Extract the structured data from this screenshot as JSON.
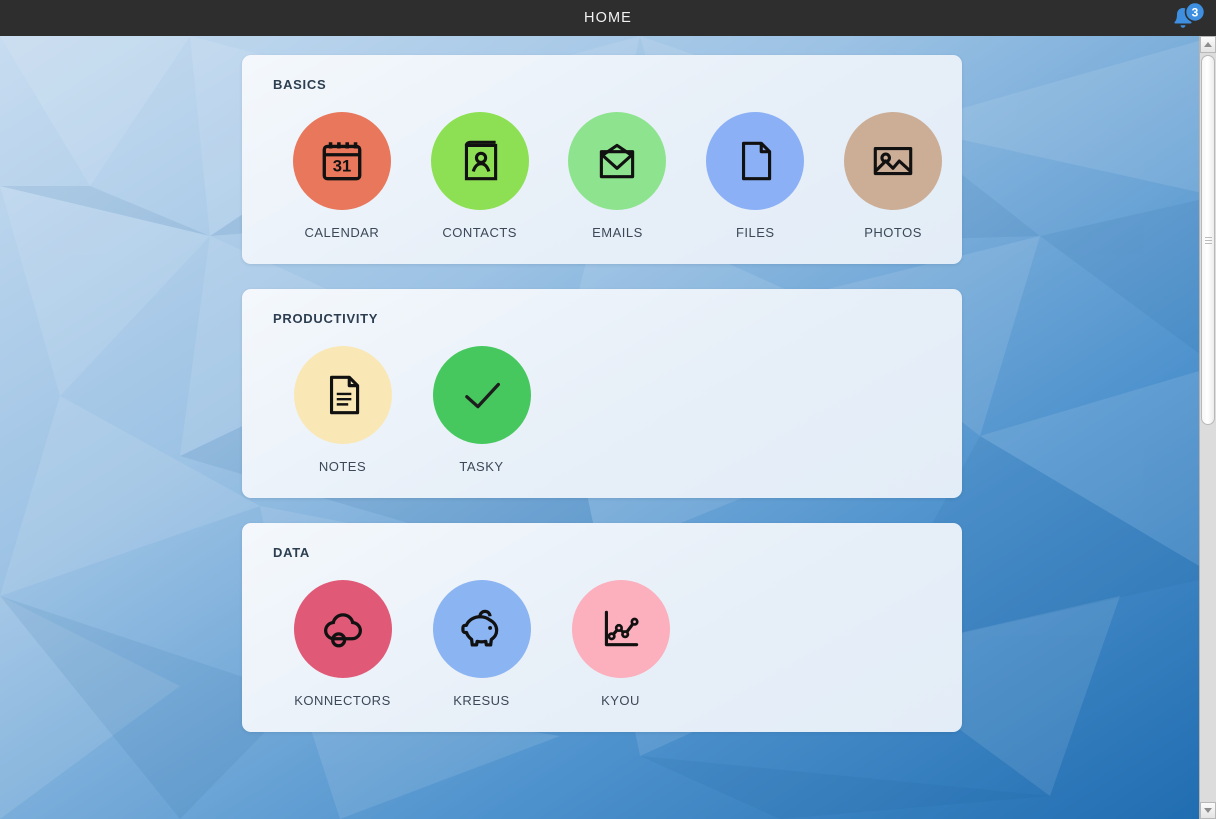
{
  "titlebar": {
    "title": "HOME",
    "notification_icon": "bell-icon",
    "notification_count": "3",
    "badge_color": "#3e8fe0",
    "bar_color": "#2e2e2e"
  },
  "background": {
    "style": "low-poly",
    "color_light": "#bcd7ee",
    "color_dark": "#2472b4"
  },
  "scrollbar": {
    "up_arrow": "caret-up-icon",
    "down_arrow": "caret-down-icon",
    "thumb": "scrollbar-thumb"
  },
  "sections": [
    {
      "title": "BASICS",
      "apps": [
        {
          "label": "CALENDAR",
          "icon": "calendar-icon",
          "color": "#e8775c"
        },
        {
          "label": "CONTACTS",
          "icon": "address-book-icon",
          "color": "#8de054"
        },
        {
          "label": "EMAILS",
          "icon": "envelope-icon",
          "color": "#8ee48e"
        },
        {
          "label": "FILES",
          "icon": "document-icon",
          "color": "#8bb0f6"
        },
        {
          "label": "PHOTOS",
          "icon": "image-icon",
          "color": "#ccae97"
        }
      ]
    },
    {
      "title": "PRODUCTIVITY",
      "apps": [
        {
          "label": "NOTES",
          "icon": "note-lines-icon",
          "color": "#f9e8b6"
        },
        {
          "label": "TASKY",
          "icon": "checkmark-icon",
          "color": "#46c85f"
        }
      ]
    },
    {
      "title": "DATA",
      "apps": [
        {
          "label": "KONNECTORS",
          "icon": "cloud-node-icon",
          "color": "#e05a78"
        },
        {
          "label": "KRESUS",
          "icon": "piggy-bank-icon",
          "color": "#8bb4f2"
        },
        {
          "label": "KYOU",
          "icon": "line-chart-icon",
          "color": "#fcafbd"
        }
      ]
    }
  ]
}
